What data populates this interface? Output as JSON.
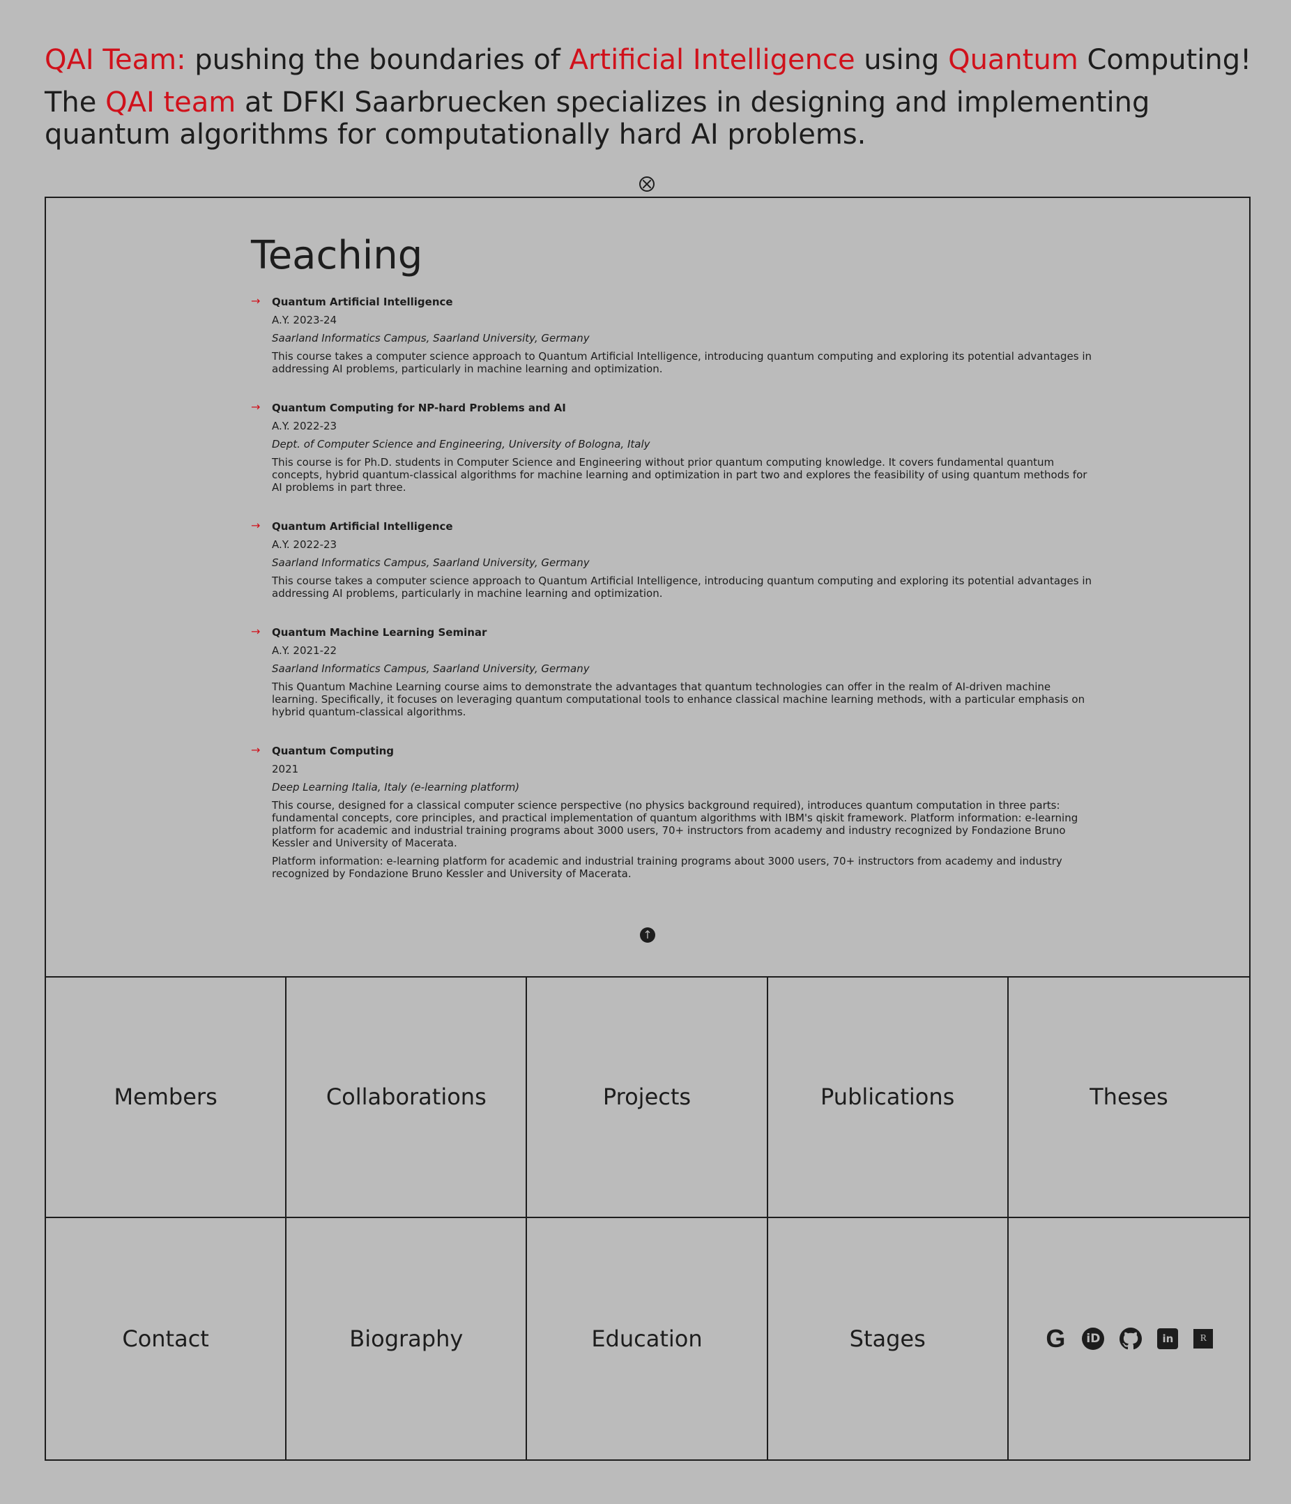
{
  "header": {
    "headline": {
      "part1": "QAI Team:",
      "part2": " pushing the boundaries of ",
      "part3": "Artificial Intelligence",
      "part4": " using ",
      "part5": "Quantum",
      "part6": " Computing!"
    },
    "intro": {
      "part1": "The ",
      "part2": "QAI team",
      "part3": " at DFKI Saarbruecken specializes in designing and implementing quantum algorithms for computationally hard AI problems."
    }
  },
  "icons": {
    "close": "close-circle-icon",
    "up": "arrow-up-circle-icon",
    "course_bullet": "→"
  },
  "teaching": {
    "title": "Teaching",
    "courses": [
      {
        "title": "Quantum Artificial Intelligence",
        "year": "A.Y. 2023-24",
        "place": "Saarland Informatics Campus, Saarland University, Germany",
        "description": "This course takes a computer science approach to Quantum Artificial Intelligence, introducing quantum computing and exploring its potential advantages in addressing AI problems, particularly in machine learning and optimization."
      },
      {
        "title": "Quantum Computing for NP-hard Problems and AI",
        "year": "A.Y. 2022-23",
        "place": "Dept. of Computer Science and Engineering, University of Bologna, Italy",
        "description": "This course is for Ph.D. students in Computer Science and Engineering without prior quantum computing knowledge. It covers fundamental quantum concepts, hybrid quantum-classical algorithms for machine learning and optimization in part two and explores the feasibility of using quantum methods for AI problems in part three."
      },
      {
        "title": "Quantum Artificial Intelligence",
        "year": "A.Y. 2022-23",
        "place": "Saarland Informatics Campus, Saarland University, Germany",
        "description": "This course takes a computer science approach to Quantum Artificial Intelligence, introducing quantum computing and exploring its potential advantages in addressing AI problems, particularly in machine learning and optimization."
      },
      {
        "title": "Quantum Machine Learning Seminar",
        "year": "A.Y. 2021-22",
        "place": "Saarland Informatics Campus, Saarland University, Germany",
        "description": "This Quantum Machine Learning course aims to demonstrate the advantages that quantum technologies can offer in the realm of AI-driven machine learning. Specifically, it focuses on leveraging quantum computational tools to enhance classical machine learning methods, with a particular emphasis on hybrid quantum-classical algorithms."
      },
      {
        "title": "Quantum Computing",
        "year": "2021",
        "place": "Deep Learning Italia, Italy (e-learning platform)",
        "description": "This course, designed for a classical computer science perspective (no physics background required), introduces quantum computation in three parts: fundamental concepts, core principles, and practical implementation of quantum algorithms with IBM's qiskit framework. Platform information: e-learning platform for academic and industrial training programs about 3000 users, 70+ instructors from academy and industry recognized by Fondazione Bruno Kessler and University of Macerata.",
        "extra": "Platform information: e-learning platform for academic and industrial training programs about 3000 users, 70+ instructors from academy and industry recognized by Fondazione Bruno Kessler and University of Macerata."
      }
    ]
  },
  "nav": {
    "members": "Members",
    "collaborations": "Collaborations",
    "projects": "Projects",
    "publications": "Publications",
    "theses": "Theses",
    "contact": "Contact",
    "biography": "Biography",
    "education": "Education",
    "stages": "Stages"
  },
  "social": {
    "google_scholar": "G",
    "orcid": "iD",
    "github": "github-icon",
    "linkedin": "in",
    "researchgate": "R"
  }
}
